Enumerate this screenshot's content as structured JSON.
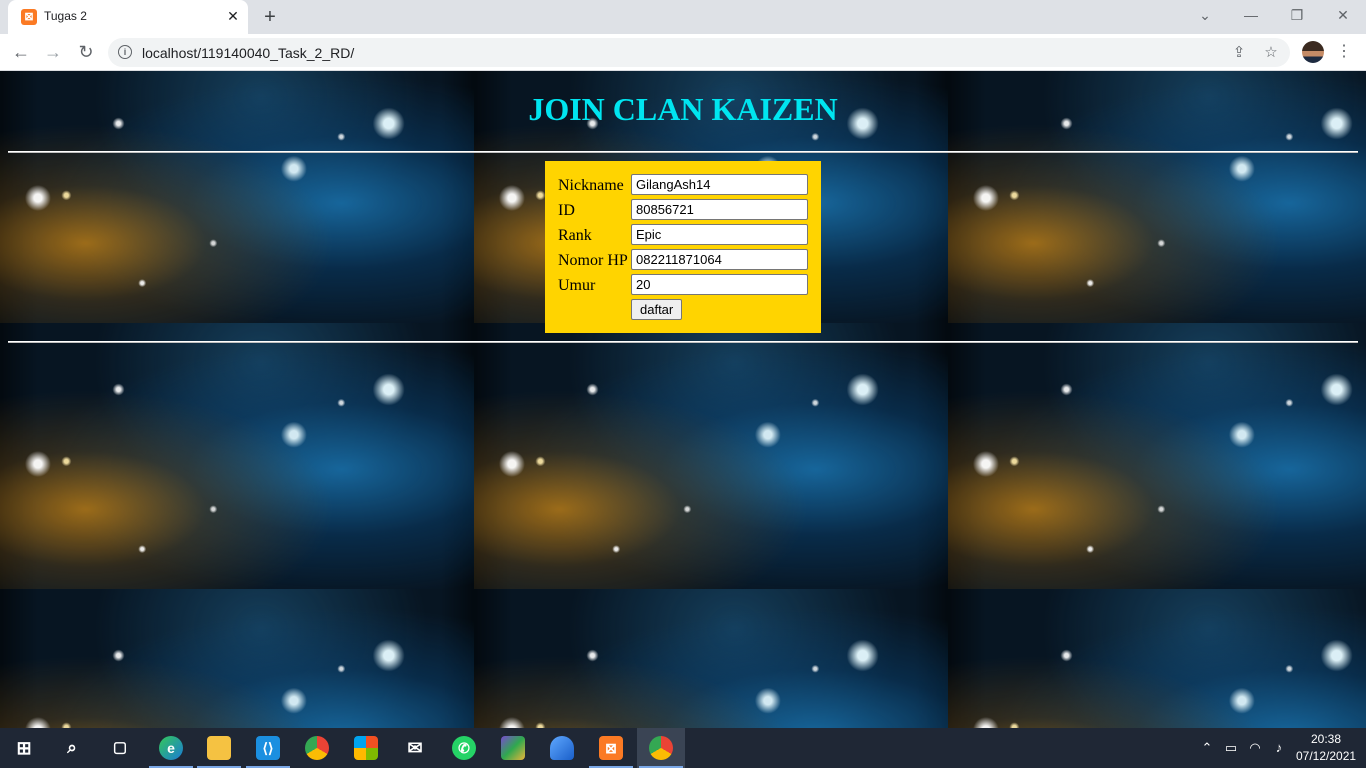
{
  "browser": {
    "tab_title": "Tugas 2",
    "tab_close_glyph": "✕",
    "new_tab_glyph": "+",
    "url": "localhost/119140040_Task_2_RD/",
    "window_controls": [
      "⌄",
      "—",
      "❐",
      "✕"
    ]
  },
  "page": {
    "heading": "JOIN CLAN KAIZEN",
    "heading_color": "#00e5f0",
    "form_background": "#ffd400",
    "fields": [
      {
        "label": "Nickname",
        "value": "GilangAsh14"
      },
      {
        "label": "ID",
        "value": "80856721"
      },
      {
        "label": "Rank",
        "value": "Epic"
      },
      {
        "label": "Nomor HP",
        "value": "082211871064"
      },
      {
        "label": "Umur",
        "value": "20"
      }
    ],
    "submit_label": "daftar"
  },
  "taskbar": {
    "apps": [
      "start-icon",
      "search-icon",
      "task-view-icon",
      "edge-icon",
      "file-explorer-icon",
      "vscode-icon",
      "chrome-icon",
      "store-icon",
      "mail-icon",
      "whatsapp-icon",
      "winrar-icon",
      "wireshark-icon",
      "xampp-icon",
      "chrome-profile-icon"
    ],
    "time": "20:38",
    "date": "07/12/2021"
  }
}
